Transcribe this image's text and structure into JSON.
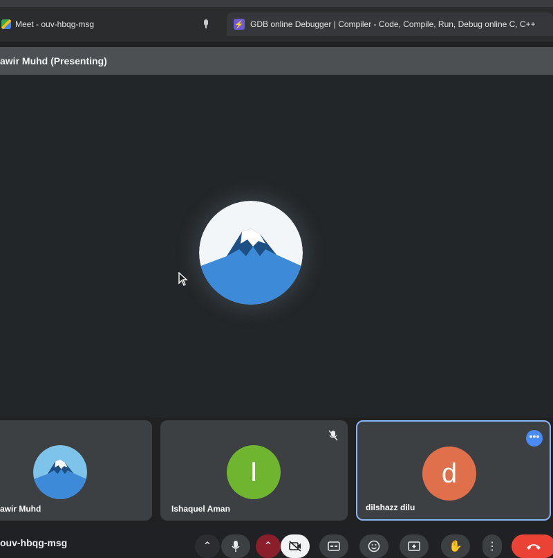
{
  "tabs": [
    {
      "label": "Meet - ouv-hbqg-msg",
      "icon": "google-meet-icon"
    },
    {
      "label": "GDB online Debugger | Compiler - Code, Compile, Run, Debug online C, C++",
      "icon": "gdb-favicon"
    }
  ],
  "presenter": {
    "label": "awir Muhd (Presenting)"
  },
  "participants": [
    {
      "name": "awir Muhd",
      "avatar": "mountain-avatar"
    },
    {
      "name": "Ishaquel Aman",
      "initial": "I",
      "color": "#6fb52f",
      "muted": true
    },
    {
      "name": "dilshazz dilu",
      "initial": "d",
      "color": "#e0704b",
      "active": true
    }
  ],
  "meeting_code": "ouv-hbqg-msg",
  "controls": [
    "chevron-up",
    "microphone",
    "chevron-up",
    "camera-off",
    "captions",
    "emoji",
    "present",
    "raise-hand",
    "more",
    "leave-call"
  ],
  "colors": {
    "accent": "#8ab4f8",
    "leave": "#ea4335",
    "mic_off": "#8a1f2b"
  }
}
